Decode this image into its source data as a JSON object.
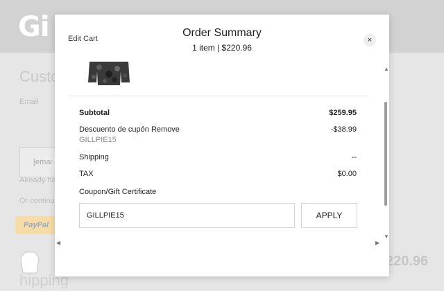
{
  "background": {
    "logo": "Gi",
    "title": "Custo",
    "email_label": "Email",
    "field_placeholder": "[emai",
    "already_text": "Already ha",
    "continue_text": "Or continu",
    "paypal_label": "PayPal",
    "price": "220.96",
    "shipping_heading": "hipping"
  },
  "modal": {
    "edit_cart": "Edit Cart",
    "title": "Order Summary",
    "subtitle": "1 item | $220.96",
    "close_glyph": "×"
  },
  "summary": {
    "subtotal_label": "Subtotal",
    "subtotal_value": "$259.95",
    "discount_label": "Descuento de cupón Remove",
    "discount_code": "GILLPIE15",
    "discount_value": "-$38.99",
    "shipping_label": "Shipping",
    "shipping_value": "--",
    "tax_label": "TAX",
    "tax_value": "$0.00"
  },
  "coupon": {
    "label": "Coupon/Gift Certificate",
    "value": "GILLPIE15",
    "apply_label": "APPLY"
  },
  "scroll": {
    "up": "▲",
    "down": "▼",
    "left": "◀",
    "right": "▶"
  },
  "icons": {
    "close": "close-icon",
    "product": "jacket-thumbnail"
  }
}
